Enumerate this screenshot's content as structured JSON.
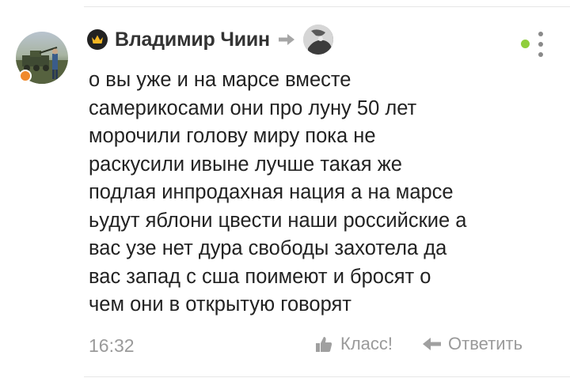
{
  "comment": {
    "author": "Владимир Чиин",
    "text": "о вы уже и на марсе вместе\nсамерикосами они про луну 50 лет\nморочили голову миру пока не\nраскусили  ивыне  лучше такая же\nподлая инпродахная нация а на марсе\nьудут яблони цвести наши российские а\nвас узе нет  дура свободы захотела да\nвас запад с сша поимеют и бросят  о\nчем они в открытую говорят",
    "time": "16:32",
    "actions": {
      "like_label": "Класс!",
      "reply_label": "Ответить"
    }
  },
  "colors": {
    "online_indicator": "#f08a2c",
    "status_dot": "#8fce3b",
    "muted_text": "#9a9a9a"
  },
  "icons": [
    "crown-icon",
    "reply-arrow-icon",
    "thumbs-up-icon",
    "reply-back-arrow-icon",
    "more-menu-icon"
  ]
}
